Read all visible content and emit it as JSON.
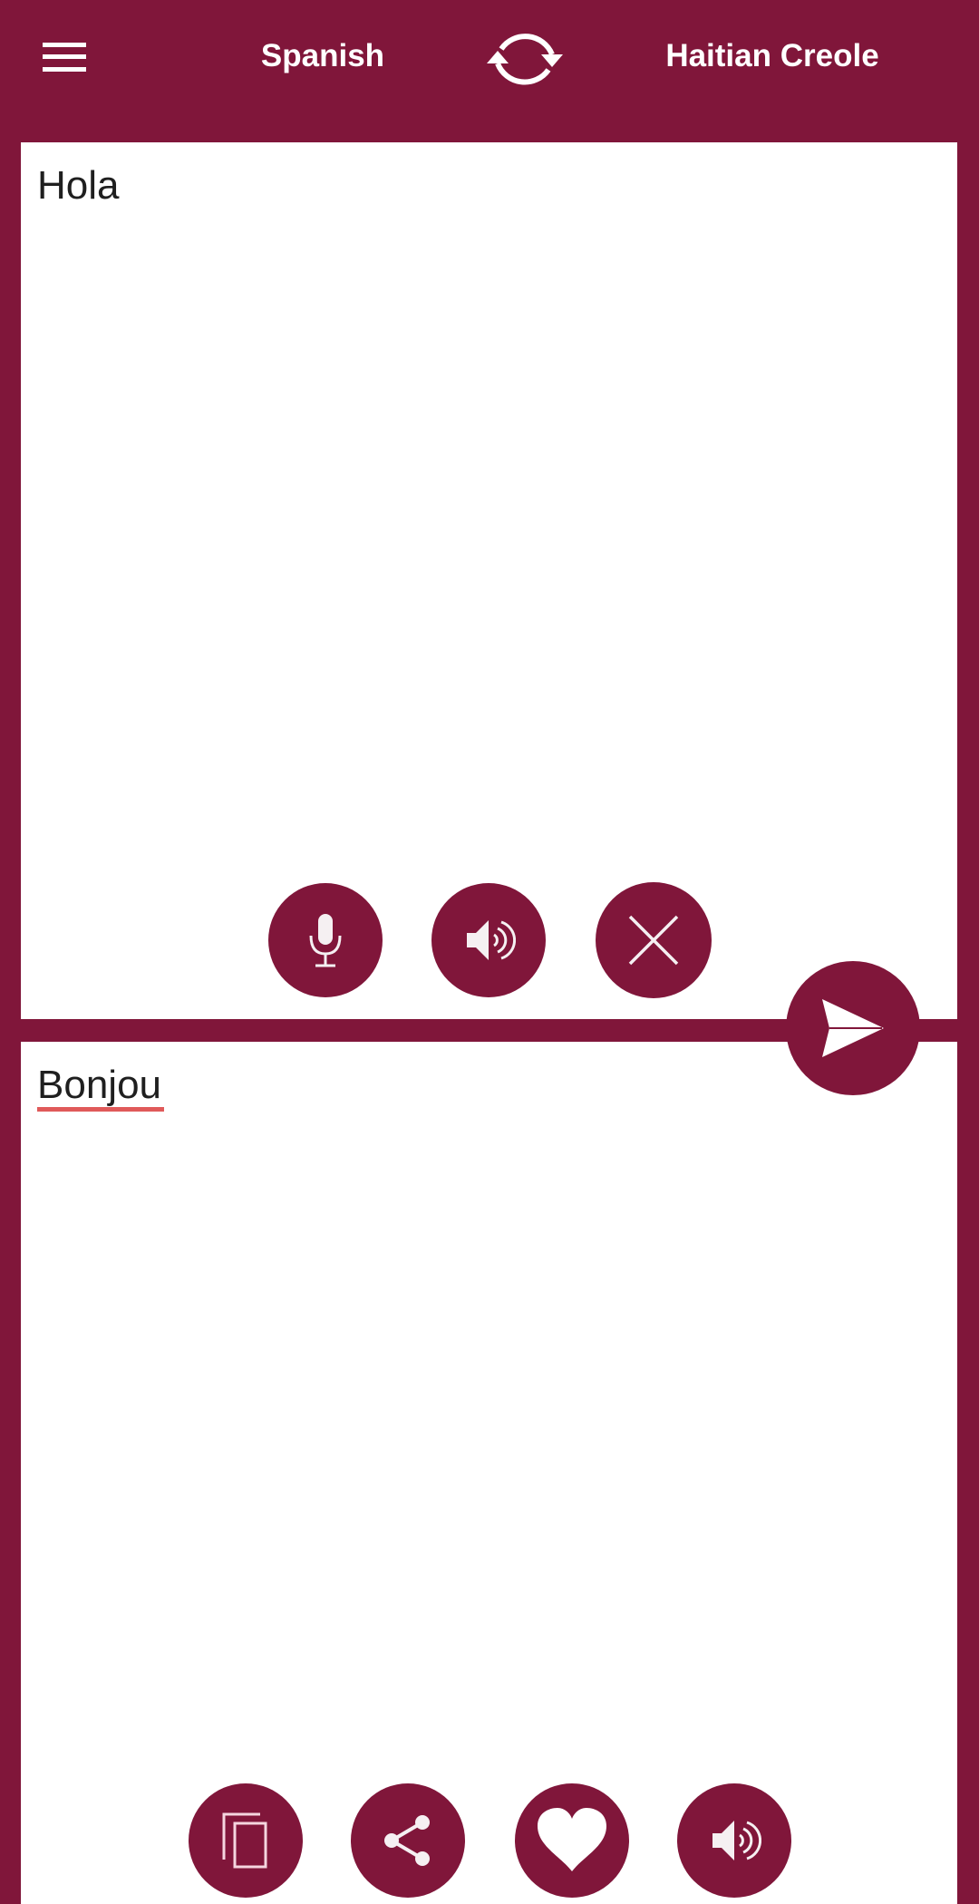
{
  "header": {
    "menu_icon": "hamburger-menu-icon",
    "source_language": "Spanish",
    "swap_icon": "swap-languages-icon",
    "target_language": "Haitian Creole"
  },
  "source_panel": {
    "text": "Hola",
    "actions": [
      {
        "name": "microphone",
        "icon": "microphone-icon"
      },
      {
        "name": "speak-source",
        "icon": "speaker-icon"
      },
      {
        "name": "clear",
        "icon": "close-icon"
      }
    ]
  },
  "translate_button": {
    "icon": "send-icon"
  },
  "target_panel": {
    "text": "Bonjou",
    "actions": [
      {
        "name": "copy",
        "icon": "copy-icon"
      },
      {
        "name": "share",
        "icon": "share-icon"
      },
      {
        "name": "favorite",
        "icon": "heart-icon"
      },
      {
        "name": "speak-target",
        "icon": "speaker-icon"
      }
    ]
  },
  "colors": {
    "brand": "#80163a",
    "panel_background": "#ffffff",
    "text": "#1f1f1f",
    "spellcheck_underline": "#e05a5a"
  }
}
